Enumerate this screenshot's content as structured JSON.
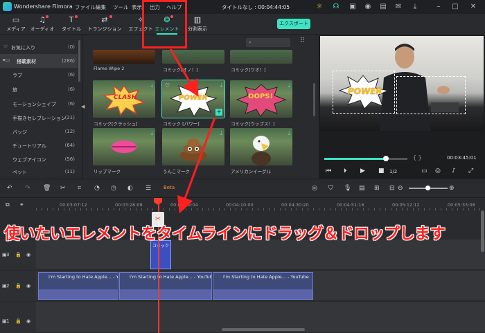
{
  "app": {
    "name": "Wondershare Filmora",
    "title": "タイトルなし : 00:04:44:05"
  },
  "menus": [
    "ファイル",
    "編集",
    "ツール",
    "表示",
    "出力",
    "ヘルプ"
  ],
  "toolbar": {
    "tabs": [
      {
        "label": "メディア",
        "icon": "folder-icon"
      },
      {
        "label": "オーディオ",
        "icon": "music-note-icon"
      },
      {
        "label": "タイトル",
        "icon": "text-icon"
      },
      {
        "label": "トランジション",
        "icon": "transition-icon"
      },
      {
        "label": "エフェクト",
        "icon": "effects-icon"
      },
      {
        "label": "エレメント",
        "icon": "element-icon"
      },
      {
        "label": "分割表示",
        "icon": "split-screen-icon"
      }
    ],
    "active_tab": "エレメント",
    "export_label": "エクスポート"
  },
  "sidebar": {
    "items": [
      {
        "label": "お気に入り",
        "count": "(0)"
      },
      {
        "label": "搭載素材",
        "count": "(286)"
      },
      {
        "label": "ラブ",
        "count": "(6)"
      },
      {
        "label": "旅",
        "count": "(6)"
      },
      {
        "label": "モーションシェイプ",
        "count": "(6)"
      },
      {
        "label": "手描きセレブレーション",
        "count": "(21)"
      },
      {
        "label": "バッジ",
        "count": "(12)"
      },
      {
        "label": "チュートリアル",
        "count": "(64)"
      },
      {
        "label": "ウェブアイコン",
        "count": "(56)"
      },
      {
        "label": "ペット",
        "count": "(11)"
      }
    ]
  },
  "grid": {
    "row_partial": [
      "Flame Wipe 2",
      "コミック[オノ！]",
      "コミック[ワオ！]"
    ],
    "row1": [
      {
        "label": "コミック[クラッシュ]",
        "art": "CLASH"
      },
      {
        "label": "コミック [パワー]",
        "art": "POWER"
      },
      {
        "label": "コミック[ウップス！]",
        "art": "OOPS!"
      }
    ],
    "row2": [
      {
        "label": "リップマーク"
      },
      {
        "label": "うんこマーク"
      },
      {
        "label": "アメリカンイーグル"
      }
    ]
  },
  "preview": {
    "overlay_text": "POWER",
    "timecode": "00:03:45:01",
    "speed": "1/2",
    "brackets": "{ }"
  },
  "timeline": {
    "ticks": [
      "00:03:07:12",
      "00:03:28:08",
      "00:03:49:04",
      "00:04:10:00",
      "00:04:30:20",
      "00:04:51:16",
      "00:05:12:12",
      "00:05:33:08"
    ],
    "track_numbers": [
      "3",
      "2",
      "1"
    ],
    "element_clip_label": "コミック",
    "video_clip_label": "I'm Starting to Hate Apple... - YouTube",
    "new_badge": "Beta"
  },
  "annotation": {
    "text": "使いたいエレメントをタイムラインにドラッグ＆ドロップします"
  },
  "colors": {
    "accent": "#3ee3c1",
    "annotation_red": "#ff1f1f",
    "clip_blue": "#3c4fc0"
  }
}
